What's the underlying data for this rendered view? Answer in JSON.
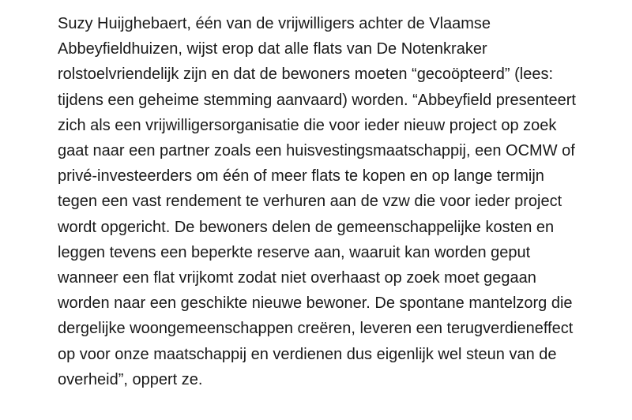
{
  "article": {
    "lines": [
      "Suzy Huijghebaert, één van de vrijwilligers achter de Vlaamse",
      "Abbeyfieldhuizen, wijst erop dat alle flats van De Notenkraker",
      "rolstoelvriendelijk zijn en dat de bewoners moeten “gecoöpteerd” (lees:",
      "tijdens een geheime stemming aanvaard) worden. “Abbeyfield presenteert",
      "zich als een vrijwilligersorganisatie die voor ieder nieuw project op zoek",
      "gaat naar een partner zoals een huisvestingsmaatschappij, een OCMW of",
      "privé-investeerders om één of meer flats te kopen en op lange termijn",
      "tegen een vast rendement te verhuren aan de vzw die voor ieder project",
      "wordt opgericht. De bewoners delen de gemeenschappelijke kosten en",
      "leggen tevens een beperkte reserve aan, waaruit kan worden geput",
      "wanneer een flat vrijkomt zodat niet overhaast op zoek moet gegaan",
      "worden naar een geschikte nieuwe bewoner. De spontane mantelzorg die",
      "dergelijke woongemeenschappen creëren, leveren een terugverdieneffect",
      "op voor onze maatschappij en verdienen dus eigenlijk wel steun van de",
      "overheid”, oppert ze."
    ]
  }
}
